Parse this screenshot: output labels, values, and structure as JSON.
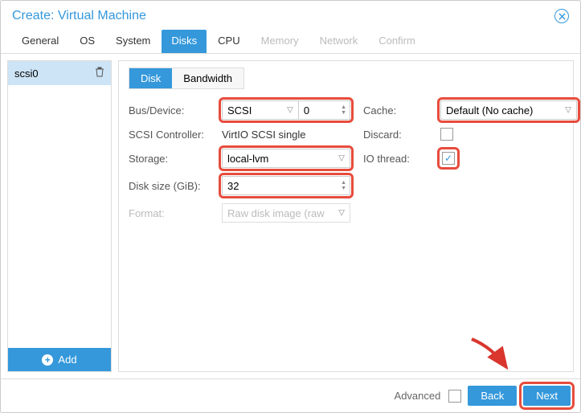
{
  "window": {
    "title": "Create: Virtual Machine"
  },
  "tabs": {
    "general": "General",
    "os": "OS",
    "system": "System",
    "disks": "Disks",
    "cpu": "CPU",
    "memory": "Memory",
    "network": "Network",
    "confirm": "Confirm"
  },
  "sidebar": {
    "disk0": "scsi0",
    "add": "Add"
  },
  "subtabs": {
    "disk": "Disk",
    "bandwidth": "Bandwidth"
  },
  "labels": {
    "bus": "Bus/Device:",
    "controller": "SCSI Controller:",
    "storage": "Storage:",
    "size": "Disk size (GiB):",
    "format": "Format:",
    "cache": "Cache:",
    "discard": "Discard:",
    "iothread": "IO thread:"
  },
  "values": {
    "bus_type": "SCSI",
    "bus_index": "0",
    "controller": "VirtIO SCSI single",
    "storage": "local-lvm",
    "size": "32",
    "format": "Raw disk image (raw",
    "cache": "Default (No cache)",
    "discard_checked": "",
    "iothread_checked": "✓"
  },
  "footer": {
    "advanced": "Advanced",
    "back": "Back",
    "next": "Next"
  }
}
